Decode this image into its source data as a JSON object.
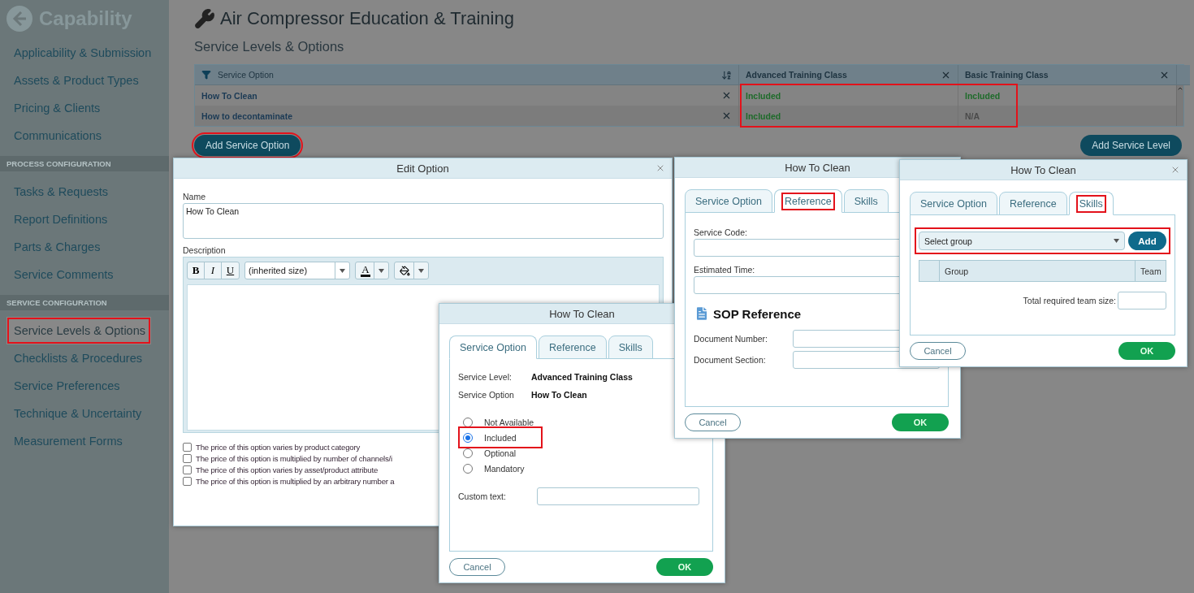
{
  "sidebar": {
    "title": "Capability",
    "groups": [
      {
        "items": [
          {
            "label": "Applicability & Submission",
            "selected": false,
            "highlighted": false
          },
          {
            "label": "Assets & Product Types",
            "selected": false,
            "highlighted": false
          },
          {
            "label": "Pricing & Clients",
            "selected": false,
            "highlighted": false
          },
          {
            "label": "Communications",
            "selected": false,
            "highlighted": false
          }
        ]
      },
      {
        "heading": "PROCESS CONFIGURATION",
        "items": [
          {
            "label": "Tasks & Requests",
            "selected": false,
            "highlighted": false
          },
          {
            "label": "Report Definitions",
            "selected": false,
            "highlighted": false
          },
          {
            "label": "Parts & Charges",
            "selected": false,
            "highlighted": false
          },
          {
            "label": "Service Comments",
            "selected": false,
            "highlighted": false
          }
        ]
      },
      {
        "heading": "SERVICE CONFIGURATION",
        "items": [
          {
            "label": "Service Levels & Options",
            "selected": true,
            "highlighted": true
          },
          {
            "label": "Checklists & Procedures",
            "selected": false,
            "highlighted": false
          },
          {
            "label": "Service Preferences",
            "selected": false,
            "highlighted": false
          },
          {
            "label": "Technique & Uncertainty",
            "selected": false,
            "highlighted": false
          },
          {
            "label": "Measurement Forms",
            "selected": false,
            "highlighted": false
          }
        ]
      }
    ]
  },
  "page": {
    "title": "Air Compressor Education & Training",
    "subtitle": "Service Levels & Options"
  },
  "table": {
    "levels_highlighted": true,
    "columns": [
      {
        "label": "Service Option",
        "kind": "name"
      },
      {
        "label": "Advanced Training Class",
        "kind": "level"
      },
      {
        "label": "Basic Training Class",
        "kind": "level"
      }
    ],
    "rows": [
      {
        "cells": [
          {
            "text": "How To Clean",
            "kind": "name"
          },
          {
            "text": "Included",
            "kind": "included"
          },
          {
            "text": "Included",
            "kind": "included"
          }
        ]
      },
      {
        "cells": [
          {
            "text": "How to decontaminate",
            "kind": "name"
          },
          {
            "text": "Included",
            "kind": "included"
          },
          {
            "text": "N/A",
            "kind": "na"
          }
        ]
      }
    ]
  },
  "actions": {
    "add_option": {
      "label": "Add Service Option",
      "highlighted": true
    },
    "add_level": {
      "label": "Add Service Level",
      "highlighted": false
    }
  },
  "edit_dialog": {
    "title": "Edit Option",
    "name_label": "Name",
    "name_value": "How To Clean",
    "description_label": "Description",
    "format_buttons": [
      "B",
      "I",
      "U"
    ],
    "size_select": "(inherited size)",
    "text_color_label": "A",
    "checkboxes": [
      {
        "label": "The price of this option varies by product category",
        "checked": false
      },
      {
        "label": "The price of this option is multiplied by number of channels/i",
        "checked": false
      },
      {
        "label": "The price of this option varies by asset/product attribute",
        "checked": false
      },
      {
        "label": "The price of this option is multiplied by an arbitrary number a",
        "checked": false
      }
    ]
  },
  "option_dialogs": [
    {
      "kind": "service_option",
      "title": "How To Clean",
      "tabs": [
        {
          "label": "Service Option",
          "selected": true,
          "highlighted": false
        },
        {
          "label": "Reference",
          "selected": false,
          "highlighted": false
        },
        {
          "label": "Skills",
          "selected": false,
          "highlighted": false
        }
      ],
      "info": [
        {
          "label": "Service Level:",
          "value": "Advanced Training Class"
        },
        {
          "label": "Service Option",
          "value": "How To Clean"
        }
      ],
      "radios": [
        {
          "label": "Not Available",
          "selected": false,
          "highlighted": false
        },
        {
          "label": "Included",
          "selected": true,
          "highlighted": true
        },
        {
          "label": "Optional",
          "selected": false,
          "highlighted": false
        },
        {
          "label": "Mandatory",
          "selected": false,
          "highlighted": false
        }
      ],
      "custom_text_label": "Custom text:",
      "cancel": "Cancel",
      "ok": "OK"
    },
    {
      "kind": "reference",
      "title": "How To Clean",
      "tabs": [
        {
          "label": "Service Option",
          "selected": false,
          "highlighted": false
        },
        {
          "label": "Reference",
          "selected": true,
          "highlighted": true
        },
        {
          "label": "Skills",
          "selected": false,
          "highlighted": false
        }
      ],
      "service_code_label": "Service Code:",
      "estimated_time_label": "Estimated Time:",
      "sop_heading": "SOP Reference",
      "document_number_label": "Document Number:",
      "document_section_label": "Document Section:",
      "cancel": "Cancel",
      "ok": "OK"
    },
    {
      "kind": "skills",
      "title": "How To Clean",
      "show_close": true,
      "tabs": [
        {
          "label": "Service Option",
          "selected": false,
          "highlighted": false
        },
        {
          "label": "Reference",
          "selected": false,
          "highlighted": false
        },
        {
          "label": "Skills",
          "selected": true,
          "highlighted": true
        }
      ],
      "group_select": "Select group",
      "add": "Add",
      "selector_highlighted": true,
      "columns": [
        "Group",
        "Team"
      ],
      "team_size_label": "Total required team size:",
      "cancel": "Cancel",
      "ok": "OK"
    }
  ]
}
